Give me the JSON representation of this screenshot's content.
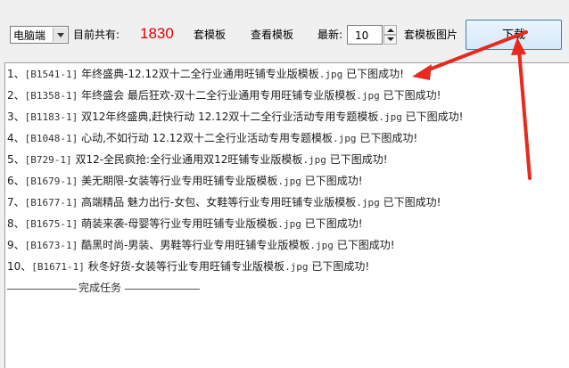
{
  "toolbar": {
    "platform_select": "电脑端",
    "total_label": "目前共有:",
    "total_count": "1830",
    "template_unit": "套模板",
    "view_templates": "查看模板",
    "latest_label": "最新:",
    "latest_value": "10",
    "images_label": "套模板图片",
    "download": "下载"
  },
  "log": {
    "lines": [
      {
        "num": "1、",
        "id": "[B1541-1]",
        "title": "年终盛典-12.12双十二全行业通用旺铺专业版模板",
        "ext": ".jpg",
        "status": "已下图成功!"
      },
      {
        "num": "2、",
        "id": "[B1358-1]",
        "title": "年终盛会 最后狂欢-双十二全行业通用专用旺铺专业版模板",
        "ext": ".jpg",
        "status": "已下图成功!"
      },
      {
        "num": "3、",
        "id": "[B1183-1]",
        "title": "双12年终盛典,赶快行动 12.12双十二全行业活动专用专题模板",
        "ext": ".jpg",
        "status": "已下图成功!"
      },
      {
        "num": "4、",
        "id": "[B1048-1]",
        "title": "心动,不如行动 12.12双十二全行业活动专用专题模板",
        "ext": ".jpg",
        "status": "已下图成功!"
      },
      {
        "num": "5、",
        "id": "[B729-1]",
        "title": "双12-全民疯抢:全行业通用双12旺铺专业版模板",
        "ext": ".jpg",
        "status": "已下图成功!"
      },
      {
        "num": "6、",
        "id": "[B1679-1]",
        "title": "美无期限-女装等行业专用旺铺专业版模板",
        "ext": ".jpg",
        "status": "已下图成功!"
      },
      {
        "num": "7、",
        "id": "[B1677-1]",
        "title": "高端精品 魅力出行-女包、女鞋等行业专用旺铺专业版模板",
        "ext": ".jpg",
        "status": "已下图成功!"
      },
      {
        "num": "8、",
        "id": "[B1675-1]",
        "title": "萌装来袭-母婴等行业专用旺铺专业版模板",
        "ext": ".jpg",
        "status": "已下图成功!"
      },
      {
        "num": "9、",
        "id": "[B1673-1]",
        "title": "酷黑时尚-男装、男鞋等行业专用旺铺专业版模板",
        "ext": ".jpg",
        "status": "已下图成功!"
      },
      {
        "num": "10、",
        "id": "[B1671-1]",
        "title": "秋冬好货-女装等行业专用旺铺专业版模板",
        "ext": ".jpg",
        "status": "已下图成功!"
      }
    ],
    "done_text": "完成任务"
  },
  "colors": {
    "count_color": "#e00000",
    "arrow_color": "#e8291c"
  }
}
